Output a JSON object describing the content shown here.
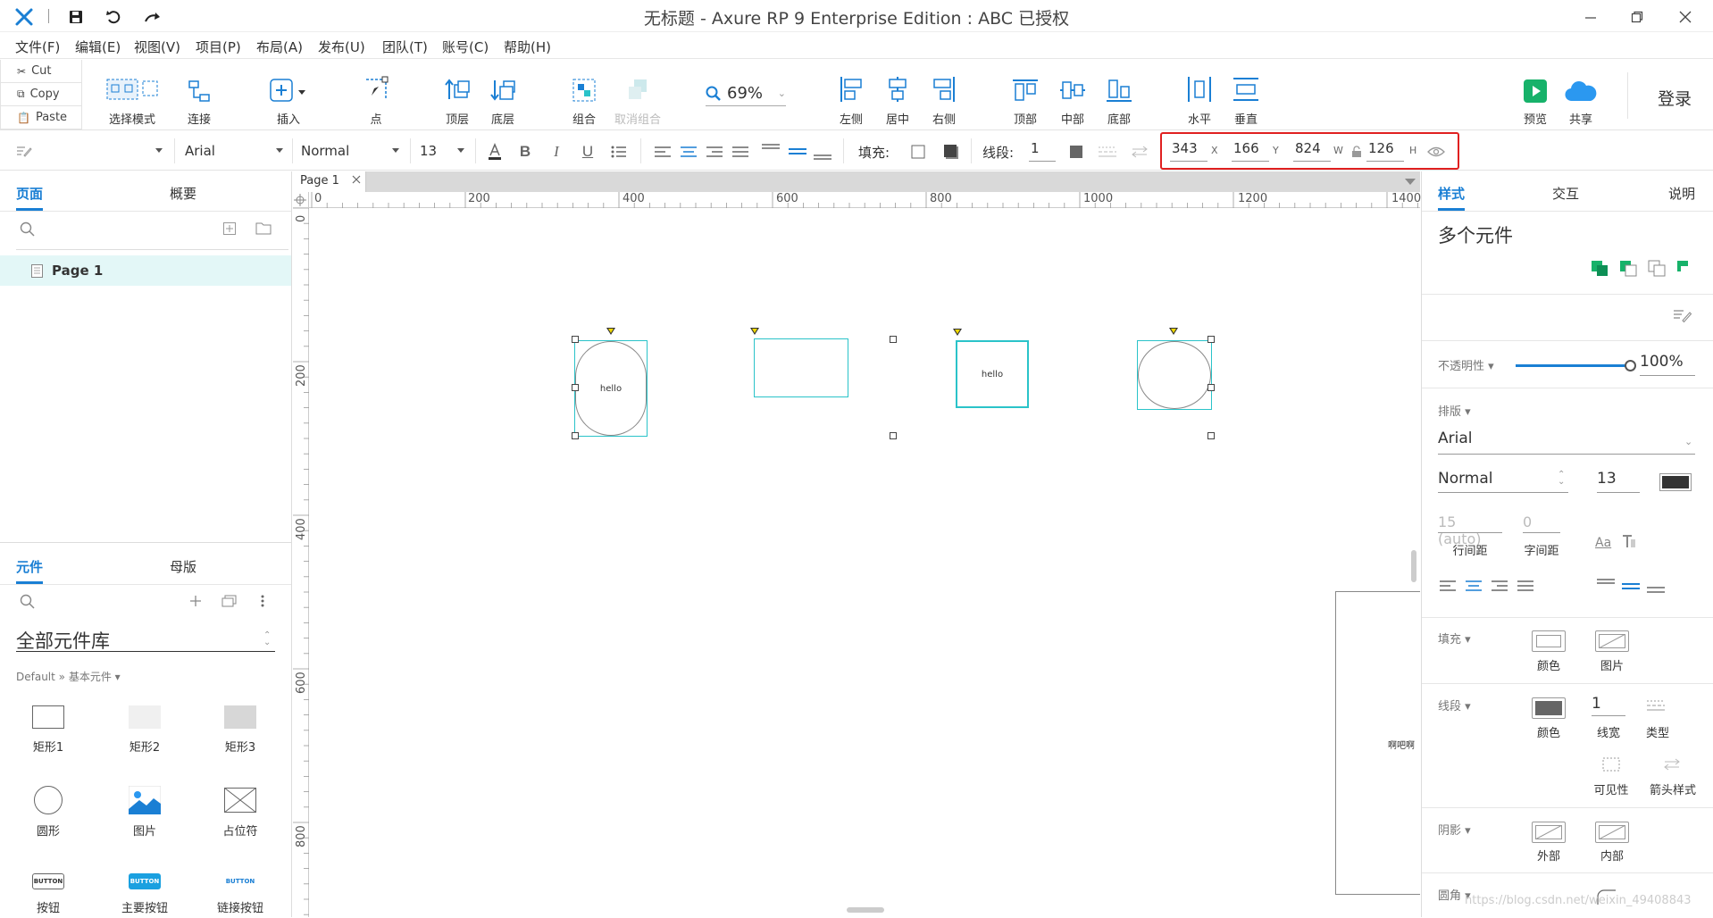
{
  "window": {
    "title": "无标题 - Axure RP 9 Enterprise Edition : ABC 已授权"
  },
  "menu": [
    "文件(F)",
    "编辑(E)",
    "视图(V)",
    "项目(P)",
    "布局(A)",
    "发布(U)",
    "团队(T)",
    "账号(C)",
    "帮助(H)"
  ],
  "clipboard": {
    "cut": "Cut",
    "copy": "Copy",
    "paste": "Paste"
  },
  "toolbar": {
    "select_mode": "选择模式",
    "connect": "连接",
    "insert": "插入",
    "point": "点",
    "front": "顶层",
    "back": "底层",
    "group": "组合",
    "ungroup": "取消组合",
    "zoom": "69%",
    "align_left": "左侧",
    "align_center": "居中",
    "align_right": "右侧",
    "align_top": "顶部",
    "align_middle": "中部",
    "align_bottom": "底部",
    "dist_horizontal": "水平",
    "dist_vertical": "垂直",
    "preview": "预览",
    "share": "共享",
    "login": "登录"
  },
  "format": {
    "font": "Arial",
    "weight": "Normal",
    "size": "13",
    "fill_label": "填充:",
    "line_label": "线段:",
    "line_width": "1",
    "x": "343",
    "x_unit": "X",
    "y": "166",
    "y_unit": "Y",
    "w": "824",
    "w_unit": "W",
    "h": "126",
    "h_unit": "H"
  },
  "pages_panel": {
    "tab_pages": "页面",
    "tab_outline": "概要",
    "page_item": "Page 1"
  },
  "library_panel": {
    "tab_widgets": "元件",
    "tab_masters": "母版",
    "library_name": "全部元件库",
    "breadcrumb": "Default » 基本元件 ▾",
    "widgets": [
      "矩形1",
      "矩形2",
      "矩形3",
      "圆形",
      "图片",
      "占位符",
      "按钮",
      "主要按钮",
      "链接按钮"
    ],
    "button_text": "BUTTON"
  },
  "canvas": {
    "tab": "Page 1",
    "ruler_h": [
      "0",
      "200",
      "400",
      "600",
      "800",
      "1000",
      "1200",
      "1400"
    ],
    "ruler_v": [
      "0",
      "200",
      "400",
      "600",
      "800"
    ],
    "shape1_text": "hello",
    "shape3_text": "hello",
    "side_text": "啊吧啊"
  },
  "inspector": {
    "tab_style": "样式",
    "tab_interact": "交互",
    "tab_notes": "说明",
    "title": "多个元件",
    "opacity_label": "不透明性 ▾",
    "opacity_value": "100%",
    "opacity": 1.0,
    "typography_label": "排版 ▾",
    "font": "Arial",
    "weight": "Normal",
    "size": "13",
    "line_spacing_value": "15 (auto)",
    "char_spacing_value": "0",
    "line_spacing_label": "行间距",
    "char_spacing_label": "字间距",
    "fill_label": "填充 ▾",
    "fill_color": "颜色",
    "fill_image": "图片",
    "line_label": "线段 ▾",
    "line_color": "颜色",
    "line_width_value": "1",
    "line_width_label": "线宽",
    "line_type": "类型",
    "visibility": "可见性",
    "arrow": "箭头样式",
    "shadow_label": "阴影 ▾",
    "shadow_outer": "外部",
    "shadow_inner": "内部",
    "corner_label": "圆角 ▾",
    "watermark": "https://blog.csdn.net/weixin_49408843"
  },
  "colors": {
    "accent": "#1a7fd4",
    "selection": "#2ac3c9",
    "preview_green": "#17b26a",
    "highlight_box": "#e02020"
  }
}
